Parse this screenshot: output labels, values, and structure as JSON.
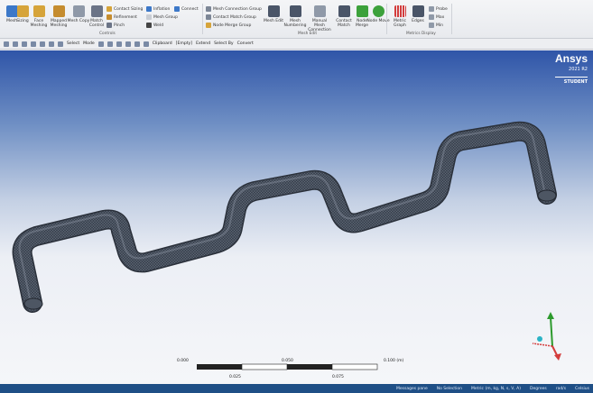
{
  "ribbon": {
    "tools": [
      "Mesh",
      "Sizing",
      "Face Meshing",
      "Mapped Meshing",
      "Mesh Copy",
      "Match Control",
      "Contact Sizing",
      "Refinement",
      "Pinch",
      "Inflation",
      "Mesh Group",
      "Weld",
      "Connect",
      "Mesh Connection Group",
      "Contact Match Group",
      "Node Merge Group",
      "Mesh Edit",
      "Mesh Numbering",
      "Manual Mesh Connection",
      "Contact Match",
      "Node Merge",
      "Node Move",
      "Metric Graph",
      "Edges",
      "Probe",
      "Max",
      "Min"
    ],
    "groups": [
      "Controls",
      "Mesh Edit",
      "Metrics Display"
    ],
    "colors": {
      "accent": "#2f6bd3",
      "gold": "#d6a43a",
      "green": "#3ca13b",
      "red": "#d33c3c"
    }
  },
  "toolbar": {
    "select": "Select",
    "mode": "Mode",
    "clipboard": "Clipboard",
    "empty": "[Empty]",
    "extend": "Extend",
    "select_by": "Select By",
    "convert": "Convert"
  },
  "brand": {
    "name": "Ansys",
    "version": "2021 R2",
    "edition": "STUDENT"
  },
  "scale": {
    "top": [
      "0.000",
      "0.050",
      "0.100 (m)"
    ],
    "bottom": [
      "0.025",
      "0.075"
    ]
  },
  "status": {
    "messages": "Messages pane",
    "selection": "No Selection",
    "units": "Metric (m, kg, N, s, V, A)",
    "angle": "Degrees",
    "rad": "rad/s",
    "temp": "Celsius"
  }
}
